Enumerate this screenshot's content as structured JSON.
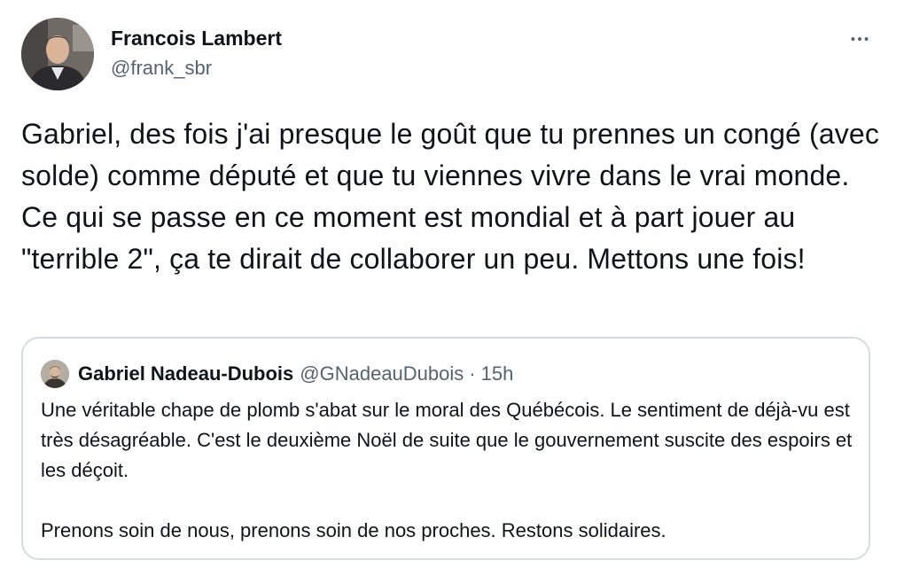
{
  "tweet": {
    "author": {
      "name": "Francois Lambert",
      "handle": "@frank_sbr"
    },
    "text": "Gabriel, des fois j'ai presque le goût que tu prennes un congé (avec solde) comme député et que tu viennes vivre dans le vrai monde. Ce qui se passe en ce moment est mondial et à part jouer au \"terrible 2\", ça te dirait de collaborer un peu. Mettons une fois!",
    "more_icon": "more-horizontal-icon",
    "quoted": {
      "name": "Gabriel Nadeau-Dubois",
      "handle": "@GNadeauDubois",
      "separator": "·",
      "time": "15h",
      "paragraphs": [
        "Une véritable chape de plomb s'abat sur le moral des Québécois. Le sentiment de déjà-vu est très désagréable. C'est le deuxième Noël de suite que le gouvernement suscite des espoirs et les déçoit.",
        "Prenons soin de nous, prenons soin de nos proches. Restons solidaires."
      ]
    }
  },
  "colors": {
    "text": "#0f1419",
    "secondary": "#536471",
    "border": "#d6dce0",
    "background": "#ffffff"
  }
}
